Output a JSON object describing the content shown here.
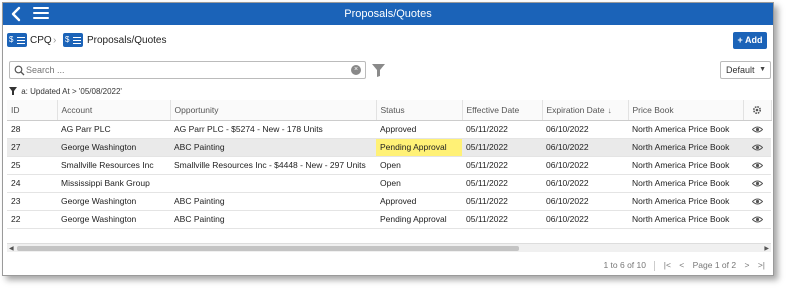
{
  "titlebar": {
    "title": "Proposals/Quotes",
    "back_icon": "chevron-left-icon",
    "menu_icon": "hamburger-menu-icon"
  },
  "breadcrumb": {
    "items": [
      {
        "label": "CPQ",
        "icon": "dollar-list-icon"
      },
      {
        "label": "Proposals/Quotes",
        "icon": "dollar-list-icon"
      }
    ],
    "separator": "›"
  },
  "toolbar": {
    "add_label": "Add",
    "add_icon": "plus-icon"
  },
  "search": {
    "placeholder": "Search ...",
    "value": "",
    "clear_symbol": "×"
  },
  "view_select": {
    "selected": "Default",
    "caret": "▼"
  },
  "active_filter": {
    "prefix": "a:",
    "text": "Updated At > '05/08/2022'"
  },
  "table": {
    "columns": [
      "ID",
      "Account",
      "Opportunity",
      "Status",
      "Effective Date",
      "Expiration Date",
      "Price Book"
    ],
    "sort_indicator": "↓",
    "rows": [
      {
        "id": "28",
        "account": "AG Parr PLC",
        "opportunity": "AG Parr PLC - $5274 - New - 178 Units",
        "status": "Approved",
        "effective": "05/11/2022",
        "expiration": "06/10/2022",
        "price_book": "North America Price Book",
        "selected": false,
        "highlight_status": false
      },
      {
        "id": "27",
        "account": "George Washington",
        "opportunity": "ABC Painting",
        "status": "Pending Approval",
        "effective": "05/11/2022",
        "expiration": "06/10/2022",
        "price_book": "North America Price Book",
        "selected": true,
        "highlight_status": true
      },
      {
        "id": "25",
        "account": "Smallville Resources Inc",
        "opportunity": "Smallville Resources Inc - $4448 - New - 297 Units",
        "status": "Open",
        "effective": "05/11/2022",
        "expiration": "06/10/2022",
        "price_book": "North America Price Book",
        "selected": false,
        "highlight_status": false
      },
      {
        "id": "24",
        "account": "Mississippi Bank Group",
        "opportunity": "",
        "status": "Open",
        "effective": "05/11/2022",
        "expiration": "06/10/2022",
        "price_book": "North America Price Book",
        "selected": false,
        "highlight_status": false
      },
      {
        "id": "23",
        "account": "George Washington",
        "opportunity": "ABC Painting",
        "status": "Approved",
        "effective": "05/11/2022",
        "expiration": "06/10/2022",
        "price_book": "North America Price Book",
        "selected": false,
        "highlight_status": false
      },
      {
        "id": "22",
        "account": "George Washington",
        "opportunity": "ABC Painting",
        "status": "Pending Approval",
        "effective": "05/11/2022",
        "expiration": "06/10/2022",
        "price_book": "North America Price Book",
        "selected": false,
        "highlight_status": false
      }
    ]
  },
  "pager": {
    "range": "1 to 6 of 10",
    "first": "|<",
    "prev": "<",
    "page_label": "Page 1 of 2",
    "next": ">",
    "last": ">|"
  },
  "colors": {
    "brand": "#1b63b8",
    "highlight": "#fff176",
    "selected_row": "#eaeaea"
  }
}
